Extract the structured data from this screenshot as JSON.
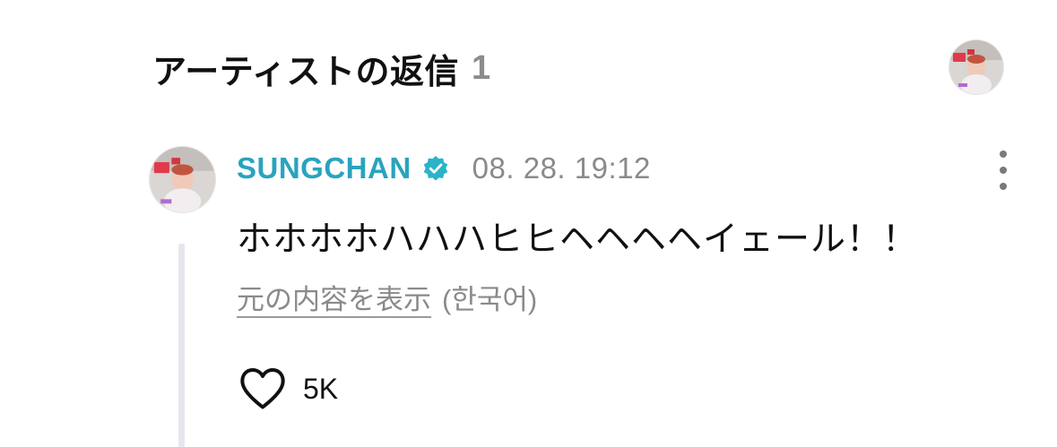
{
  "header": {
    "title": "アーティストの返信",
    "count": "1"
  },
  "reply": {
    "author": "SUNGCHAN",
    "verified_icon": "verified-check-icon",
    "timestamp": "08. 28. 19:12",
    "text": "ホホホホハハハヒヒヘヘヘヘイェール！！",
    "view_original_label": "元の内容を表示",
    "original_language": "(한국어)",
    "like_count": "5K"
  },
  "colors": {
    "author_name": "#2aa3be",
    "verified_badge": "#2bb3c9",
    "muted_text": "#8a8a8a",
    "thread_line": "#e6e6ee",
    "count_text": "#8c8c8c"
  },
  "icons": {
    "more": "more-vertical-icon",
    "like": "heart-outline-icon"
  }
}
